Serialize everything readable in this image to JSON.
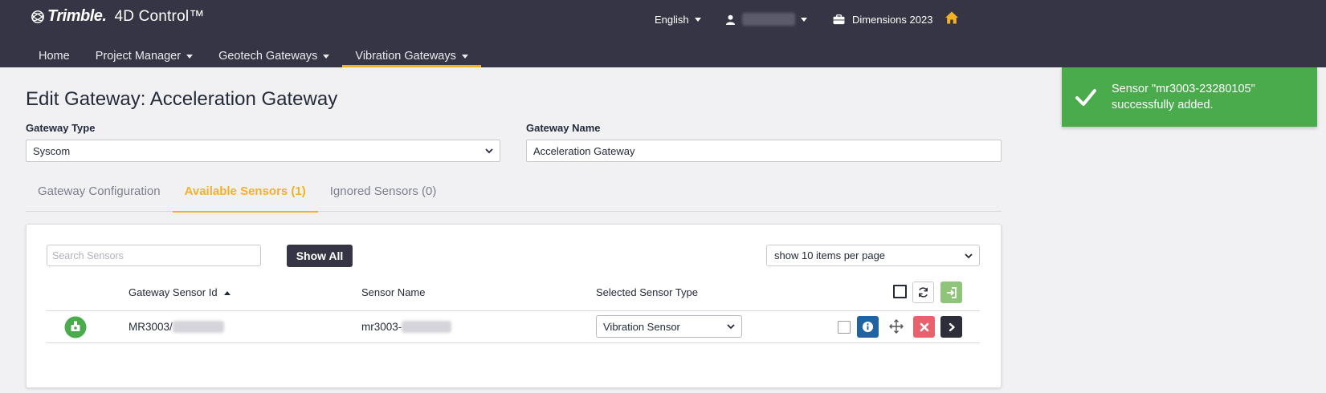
{
  "header": {
    "brand": "Trimble.",
    "product": "4D Control™",
    "language": "English",
    "project": "Dimensions 2023"
  },
  "nav": {
    "items": [
      {
        "label": "Home"
      },
      {
        "label": "Project Manager"
      },
      {
        "label": "Geotech Gateways"
      },
      {
        "label": "Vibration Gateways"
      }
    ]
  },
  "toast": {
    "message": "Sensor \"mr3003-23280105\" successfully added."
  },
  "page": {
    "title": "Edit Gateway: Acceleration Gateway",
    "gateway_type_label": "Gateway Type",
    "gateway_type_value": "Syscom",
    "gateway_name_label": "Gateway Name",
    "gateway_name_value": "Acceleration Gateway"
  },
  "tabs": [
    {
      "label": "Gateway Configuration"
    },
    {
      "label": "Available Sensors (1)"
    },
    {
      "label": "Ignored Sensors (0)"
    }
  ],
  "sensors": {
    "search_placeholder": "Search Sensors",
    "show_all_label": "Show All",
    "per_page": "show 10 items per page",
    "columns": {
      "gateway_sensor_id": "Gateway Sensor Id",
      "sensor_name": "Sensor Name",
      "selected_sensor_type": "Selected Sensor Type"
    },
    "rows": [
      {
        "gateway_sensor_id": "MR3003/",
        "sensor_name": "mr3003-",
        "sensor_type": "Vibration Sensor"
      }
    ]
  },
  "colors": {
    "header_bg": "#363545",
    "accent": "#f5b126",
    "toast_bg": "#4aab4d",
    "info_btn": "#1f63a5",
    "delete_btn": "#e8616c"
  },
  "icons": {
    "logo": "trimble-globe-icon",
    "user": "user-icon",
    "project": "briefcase-icon",
    "home": "home-icon",
    "toast": "check-icon",
    "status": "sensor-status-icon",
    "refresh": "refresh-icon",
    "import": "import-icon",
    "info": "info-icon",
    "move": "move-icon",
    "delete": "close-icon",
    "next": "chevron-right-icon"
  }
}
